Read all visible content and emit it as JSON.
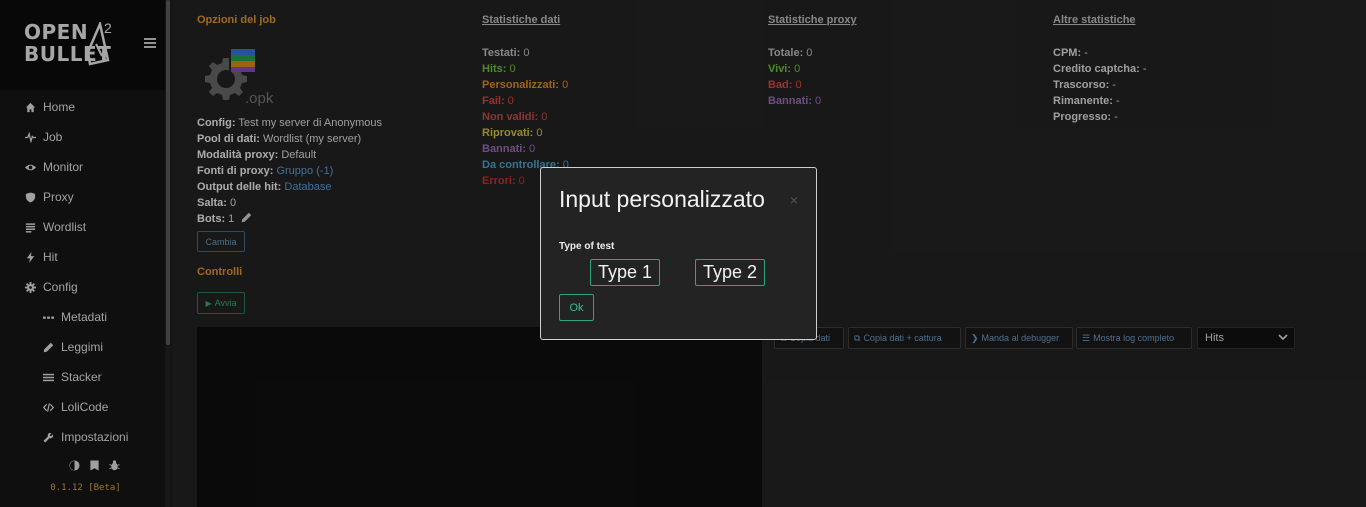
{
  "app": {
    "logo_line1": "OPEN",
    "logo_line2": "BULLET",
    "logo_sup": "2"
  },
  "sidebar": {
    "items": [
      {
        "label": "Home",
        "icon": "home-icon"
      },
      {
        "label": "Job",
        "icon": "pulse-icon"
      },
      {
        "label": "Monitor",
        "icon": "eye-icon"
      },
      {
        "label": "Proxy",
        "icon": "shield-icon"
      },
      {
        "label": "Wordlist",
        "icon": "list-icon"
      },
      {
        "label": "Hit",
        "icon": "bolt-icon"
      },
      {
        "label": "Config",
        "icon": "gear-icon"
      }
    ],
    "sub_items": [
      {
        "label": "Metadati",
        "icon": "dots-icon"
      },
      {
        "label": "Leggimi",
        "icon": "pencil-icon"
      },
      {
        "label": "Stacker",
        "icon": "bars-icon"
      },
      {
        "label": "LoliCode",
        "icon": "code-icon"
      },
      {
        "label": "Impostazioni",
        "icon": "wrench-icon"
      }
    ],
    "version": "0.1.12 [Beta]",
    "flag_colors": [
      "#009246",
      "#ffffff",
      "#ce2b37"
    ]
  },
  "job_options": {
    "title": "Opzioni del job",
    "opk_label": ".opk",
    "config_label": "Config:",
    "config_value": "Test my server di Anonymous",
    "pool_label": "Pool di dati:",
    "pool_value": "Wordlist (my server)",
    "proxy_mode_label": "Modalità proxy:",
    "proxy_mode_value": "Default",
    "proxy_sources_label": "Fonti di proxy:",
    "proxy_sources_value": "Gruppo (-1)",
    "hits_output_label": "Output delle hit:",
    "hits_output_value": "Database",
    "skip_label": "Salta:",
    "skip_value": "0",
    "bots_label": "Bots:",
    "bots_value": "1",
    "change_button": "Cambia"
  },
  "controls": {
    "title": "Controlli",
    "start_button": "Avvia"
  },
  "data_stats": {
    "title": "Statistiche dati",
    "rows": [
      {
        "label": "Testati:",
        "value": "0",
        "color": "#bdbdbd"
      },
      {
        "label": "Hits:",
        "value": "0",
        "color": "#6fbf3a"
      },
      {
        "label": "Personalizzati:",
        "value": "0",
        "color": "#e08a1e"
      },
      {
        "label": "Fail:",
        "value": "0",
        "color": "#d94444"
      },
      {
        "label": "Non validi:",
        "value": "0",
        "color": "#c44a4a"
      },
      {
        "label": "Riprovati:",
        "value": "0",
        "color": "#cfc236"
      },
      {
        "label": "Bannati:",
        "value": "0",
        "color": "#9a6bb8"
      },
      {
        "label": "Da controllare:",
        "value": "0",
        "color": "#4aa0c8"
      },
      {
        "label": "Errori:",
        "value": "0",
        "color": "#c72f2f"
      }
    ]
  },
  "proxy_stats": {
    "title": "Statistiche proxy",
    "rows": [
      {
        "label": "Totale:",
        "value": "0",
        "color": "#bdbdbd"
      },
      {
        "label": "Vivi:",
        "value": "0",
        "color": "#6fbf3a"
      },
      {
        "label": "Bad:",
        "value": "0",
        "color": "#d94444"
      },
      {
        "label": "Bannati:",
        "value": "0",
        "color": "#9a6bb8"
      }
    ]
  },
  "other_stats": {
    "title": "Altre statistiche",
    "rows": [
      {
        "label": "CPM:",
        "value": "-"
      },
      {
        "label": "Credito captcha:",
        "value": "-"
      },
      {
        "label": "Trascorso:",
        "value": "-"
      },
      {
        "label": "Rimanente:",
        "value": "-"
      },
      {
        "label": "Progresso:",
        "value": "-"
      }
    ]
  },
  "toolbar": {
    "copy_data": "Copia dati",
    "copy_data_capture": "Copia dati + cattura",
    "send_debugger": "Manda al debugger",
    "show_full_log": "Mostra log completo",
    "filter_value": "Hits"
  },
  "modal": {
    "title": "Input personalizzato",
    "close": "×",
    "label": "Type of test",
    "option1": "Type 1",
    "option2": "Type 2",
    "ok": "Ok"
  }
}
